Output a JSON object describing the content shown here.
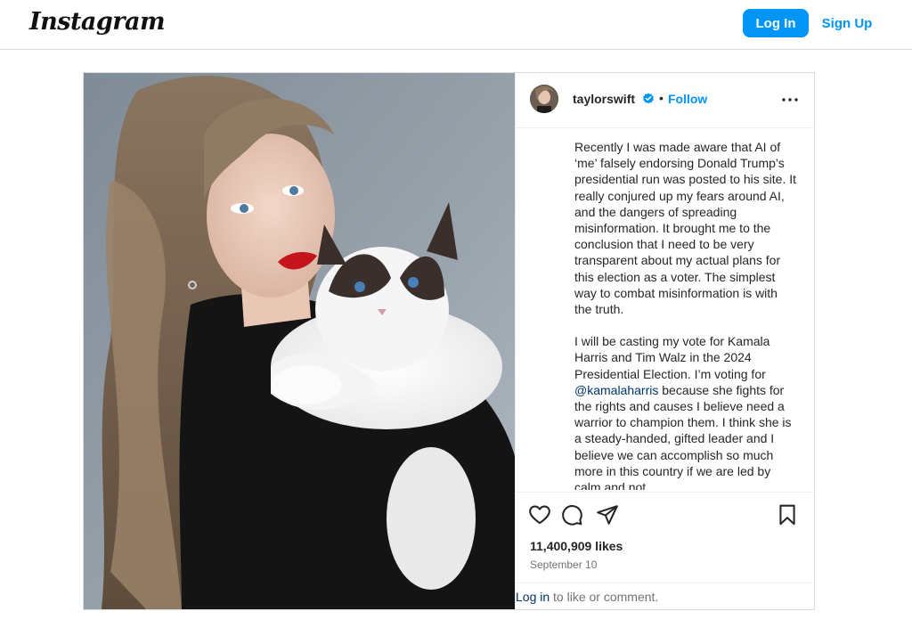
{
  "header": {
    "logo_text": "Instagram",
    "login_label": "Log In",
    "signup_label": "Sign Up"
  },
  "post": {
    "username": "taylorswift",
    "separator": "•",
    "follow_label": "Follow",
    "caption": {
      "paragraph1": "Recently I was made aware that AI of ‘me’ falsely endorsing Donald Trump’s presidential run was posted to his site. It really conjured up my fears around AI, and the dangers of spreading misinformation. It brought me to the conclusion that I need to be very transparent about my actual plans for this election as a voter. The simplest way to combat misinformation is with the truth.",
      "paragraph2_before": "I will be casting my vote for Kamala Harris and Tim Walz in the 2024 Presidential Election. I’m voting for ",
      "mention": "@kamalaharris",
      "paragraph2_after": " because she fights for the rights and causes I believe need a warrior to champion them. I think she is a steady-handed, gifted leader and I believe we can accomplish so much more in this country if we are led by calm and not"
    },
    "likes": "11,400,909 likes",
    "date": "September 10",
    "login_prompt": {
      "link": "Log in",
      "rest": " to like or comment."
    }
  },
  "colors": {
    "accent": "#0095f6",
    "link_dark": "#00376b",
    "muted": "#737373",
    "border": "#dbdbdb"
  },
  "icons": {
    "verified": "verified-badge-icon",
    "more": "more-options-icon",
    "like": "heart-icon",
    "comment": "comment-icon",
    "share": "share-icon",
    "save": "bookmark-icon"
  }
}
